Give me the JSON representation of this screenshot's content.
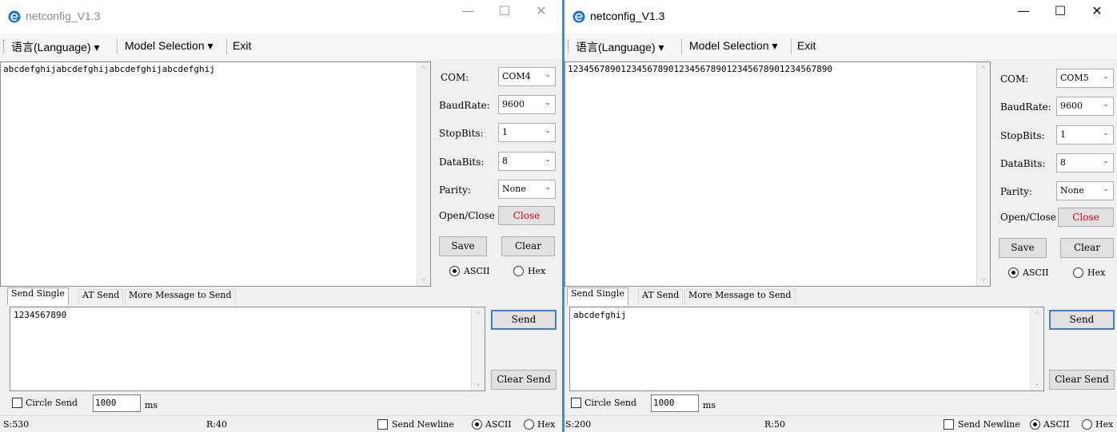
{
  "windows": [
    {
      "title": "netconfig_V1.3",
      "menu": {
        "language": "语言(Language) ▾",
        "model_selection": "Model Selection ▾",
        "exit": "Exit"
      },
      "receive_text": "abcdefghijabcdefghijabcdefghijabcdefghij",
      "settings": {
        "com_label": "COM:",
        "com_value": "COM4",
        "baud_label": "BaudRate:",
        "baud_value": "9600",
        "stopbits_label": "StopBits:",
        "stopbits_value": "1",
        "databits_label": "DataBits:",
        "databits_value": "8",
        "parity_label": "Parity:",
        "parity_value": "None",
        "openclose_label": "Open/Close",
        "openclose_button": "Close",
        "save_button": "Save",
        "clear_button": "Clear",
        "ascii_label": "ASCII",
        "hex_label": "Hex",
        "mode_selected": "ascii"
      },
      "tabs": [
        "Send Single",
        "AT Send",
        "More Message to Send"
      ],
      "send_text": "1234567890",
      "send_button": "Send",
      "clear_send_button": "Clear Send",
      "circle_send_label": "Circle Send",
      "interval_value": "1000",
      "interval_unit": "ms",
      "status": {
        "sent": "S:530",
        "received": "R:40",
        "send_newline_label": "Send Newline",
        "ascii_label": "ASCII",
        "hex_label": "Hex"
      }
    },
    {
      "title": "netconfig_V1.3",
      "menu": {
        "language": "语言(Language) ▾",
        "model_selection": "Model Selection ▾",
        "exit": "Exit"
      },
      "receive_text": "12345678901234567890123456789012345678901234567890",
      "settings": {
        "com_label": "COM:",
        "com_value": "COM5",
        "baud_label": "BaudRate:",
        "baud_value": "9600",
        "stopbits_label": "StopBits:",
        "stopbits_value": "1",
        "databits_label": "DataBits:",
        "databits_value": "8",
        "parity_label": "Parity:",
        "parity_value": "None",
        "openclose_label": "Open/Close",
        "openclose_button": "Close",
        "save_button": "Save",
        "clear_button": "Clear",
        "ascii_label": "ASCII",
        "hex_label": "Hex",
        "mode_selected": "ascii"
      },
      "tabs": [
        "Send Single",
        "AT Send",
        "More Message to Send"
      ],
      "send_text": "abcdefghij",
      "send_button": "Send",
      "clear_send_button": "Clear Send",
      "circle_send_label": "Circle Send",
      "interval_value": "1000",
      "interval_unit": "ms",
      "status": {
        "sent": "S:200",
        "received": "R:50",
        "send_newline_label": "Send Newline",
        "ascii_label": "ASCII",
        "hex_label": "Hex"
      }
    }
  ],
  "colors": {
    "close_button_text": "#e00000",
    "window_border": "#4a89c8",
    "icon_blue": "#1c6fc9"
  }
}
